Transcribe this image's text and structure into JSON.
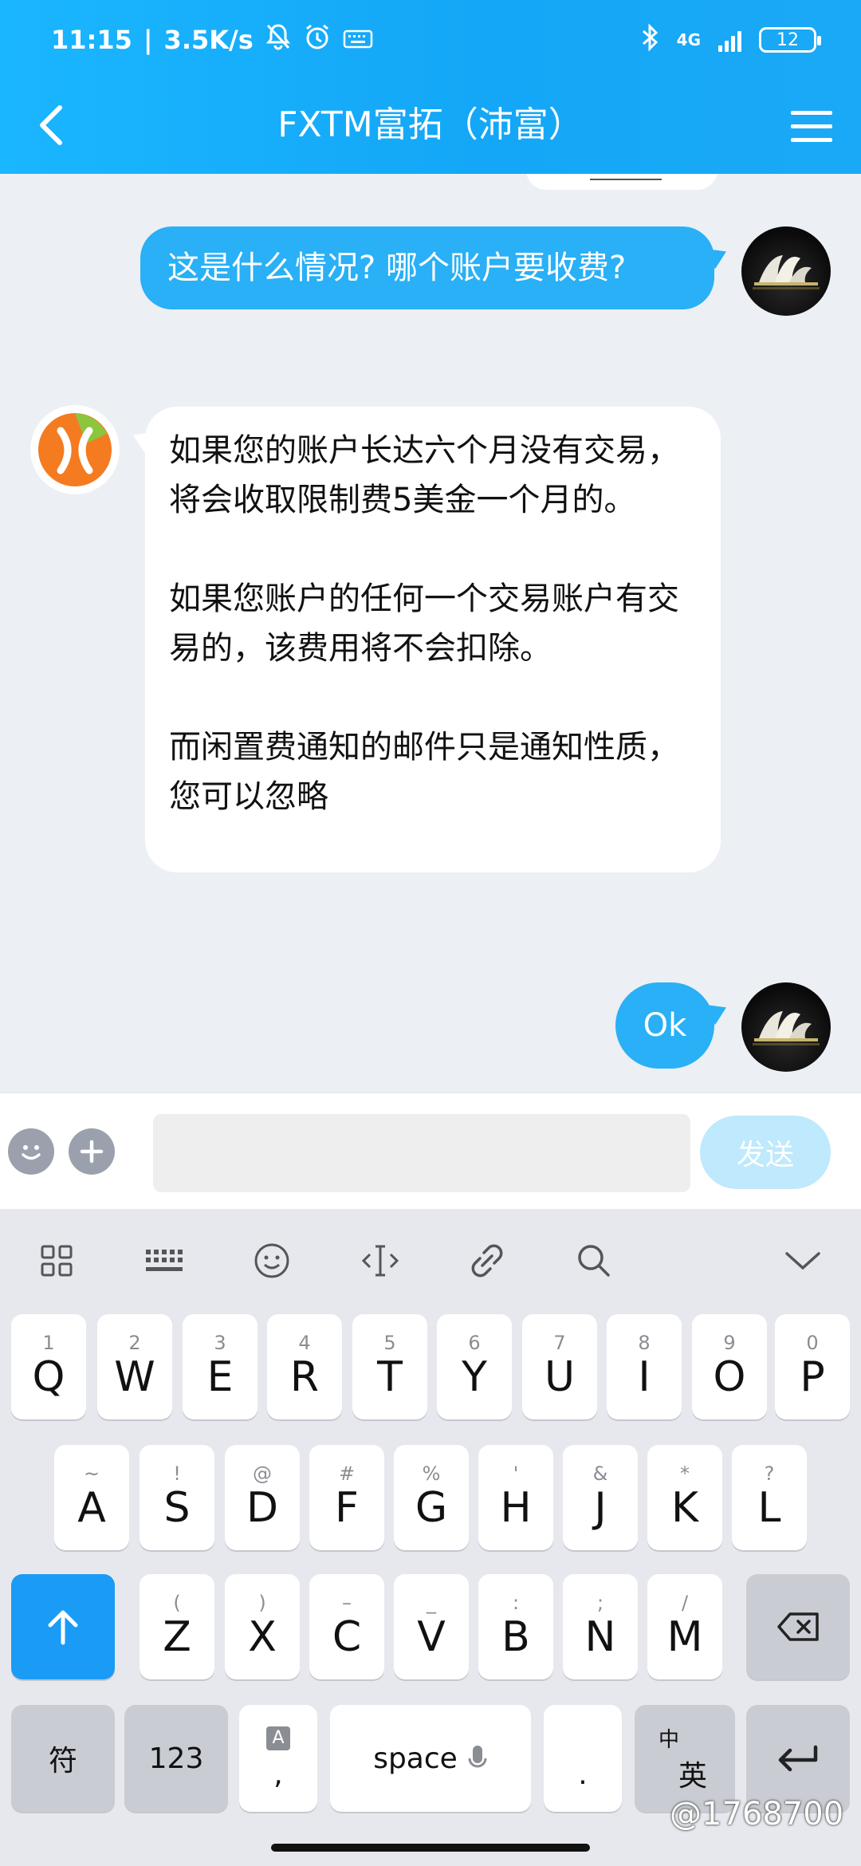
{
  "status_bar": {
    "time": "11:15",
    "net_speed": "3.5K/s",
    "network_type": "4G",
    "battery": "12",
    "icons": [
      "bell-off-icon",
      "alarm-icon",
      "keyboard-icon",
      "bluetooth-icon",
      "signal-icon",
      "battery-icon"
    ]
  },
  "nav": {
    "title": "FXTM富拓（沛富）",
    "back_icon": "chevron-left-icon",
    "menu_icon": "menu-icon"
  },
  "messages": [
    {
      "side": "out",
      "text": "这是什么情况? 哪个账户要收费?"
    },
    {
      "side": "in",
      "paragraphs": [
        "如果您的账户长达六个月没有交易，将会收取限制费5美金一个月的。",
        "如果您账户的任何一个交易账户有交易的，该费用将不会扣除。",
        "而闲置费通知的邮件只是通知性质，您可以忽略"
      ]
    },
    {
      "side": "out",
      "text": "Ok"
    }
  ],
  "input_bar": {
    "emoji_icon": "smile-icon",
    "plus_icon": "plus-icon",
    "input_value": "",
    "send_label": "发送",
    "colors": {
      "send_disabled": "#bfe9fc",
      "accent": "#29b0f6"
    }
  },
  "keyboard": {
    "toolbar_icons": [
      "grid-icon",
      "keyboard-icon",
      "emoji-icon",
      "cursor-icon",
      "link-icon",
      "search-icon",
      "chevron-down-icon"
    ],
    "row1": [
      {
        "main": "Q",
        "sub": "1"
      },
      {
        "main": "W",
        "sub": "2"
      },
      {
        "main": "E",
        "sub": "3"
      },
      {
        "main": "R",
        "sub": "4"
      },
      {
        "main": "T",
        "sub": "5"
      },
      {
        "main": "Y",
        "sub": "6"
      },
      {
        "main": "U",
        "sub": "7"
      },
      {
        "main": "I",
        "sub": "8"
      },
      {
        "main": "O",
        "sub": "9"
      },
      {
        "main": "P",
        "sub": "0"
      }
    ],
    "row2": [
      {
        "main": "A",
        "sub": "~"
      },
      {
        "main": "S",
        "sub": "!"
      },
      {
        "main": "D",
        "sub": "@"
      },
      {
        "main": "F",
        "sub": "#"
      },
      {
        "main": "G",
        "sub": "%"
      },
      {
        "main": "H",
        "sub": "'"
      },
      {
        "main": "J",
        "sub": "&"
      },
      {
        "main": "K",
        "sub": "*"
      },
      {
        "main": "L",
        "sub": "?"
      }
    ],
    "row3": [
      {
        "main": "Z",
        "sub": "("
      },
      {
        "main": "X",
        "sub": ")"
      },
      {
        "main": "C",
        "sub": "–"
      },
      {
        "main": "V",
        "sub": "_"
      },
      {
        "main": "B",
        "sub": ":"
      },
      {
        "main": "N",
        "sub": ";"
      },
      {
        "main": "M",
        "sub": "/"
      }
    ],
    "symbols_label": "符",
    "numbers_label": "123",
    "comma_label": ",",
    "comma_badge": "A",
    "space_label": "space",
    "period_label": ".",
    "lang_top": "中",
    "lang_bottom": "英"
  },
  "watermark": "@1768700"
}
